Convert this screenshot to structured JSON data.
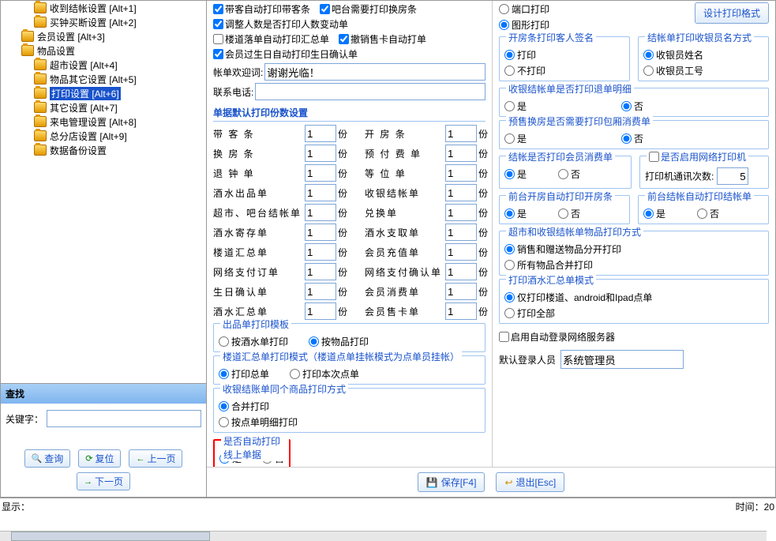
{
  "tree": [
    {
      "label": "收到结帐设置 [Alt+1]",
      "indent": 1
    },
    {
      "label": "买钟买断设置 [Alt+2]",
      "indent": 1
    },
    {
      "label": "会员设置 [Alt+3]",
      "indent": 0
    },
    {
      "label": "物品设置",
      "indent": 0
    },
    {
      "label": "超市设置 [Alt+4]",
      "indent": 1
    },
    {
      "label": "物品其它设置 [Alt+5]",
      "indent": 1
    },
    {
      "label": "打印设置 [Alt+6]",
      "indent": 1,
      "selected": true
    },
    {
      "label": "其它设置 [Alt+7]",
      "indent": 1
    },
    {
      "label": "来电管理设置 [Alt+8]",
      "indent": 1
    },
    {
      "label": "总分店设置 [Alt+9]",
      "indent": 1
    },
    {
      "label": "数据备份设置",
      "indent": 1
    }
  ],
  "find": {
    "header": "查找",
    "keyword": "关键字：",
    "q": "查询",
    "r": "复位",
    "p": "上一页",
    "n": "下一页",
    "kw_val": ""
  },
  "chk": {
    "c1": "带客自动打印带客条",
    "c2": "吧台需要打印换房条",
    "c3": "调整人数是否打印人数变动单",
    "c4": "楼道落单自动打印汇总单",
    "c5": "撤销售卡自动打单",
    "c6": "会员过生日自动打印生日确认单"
  },
  "fld": {
    "welcome_lbl": "帐单欢迎词:",
    "welcome_val": "谢谢光临！",
    "tel_lbl": "联系电话:",
    "tel_val": ""
  },
  "copies": {
    "title": "单据默认打印份数设置",
    "rows": [
      [
        "带  客  条",
        "1",
        "份",
        "开  房  条",
        "1",
        "份"
      ],
      [
        "换  房  条",
        "1",
        "份",
        "预 付 费 单",
        "1",
        "份"
      ],
      [
        "退  钟  单",
        "1",
        "份",
        "等  位  单",
        "1",
        "份"
      ],
      [
        "酒水出品单",
        "1",
        "份",
        "收银结帐单",
        "1",
        "份"
      ],
      [
        "超市、吧台结帐单",
        "1",
        "份",
        "兑换单",
        "1",
        "份"
      ],
      [
        "酒水寄存单",
        "1",
        "份",
        "酒水支取单",
        "1",
        "份"
      ],
      [
        "楼道汇总单",
        "1",
        "份",
        "会员充值单",
        "1",
        "份"
      ],
      [
        "网络支付订单",
        "1",
        "份",
        "网络支付确认单",
        "1",
        "份"
      ],
      [
        "生日确认单",
        "1",
        "份",
        "会员消费单",
        "1",
        "份"
      ],
      [
        "酒水汇总单",
        "1",
        "份",
        "会员售卡单",
        "1",
        "份"
      ]
    ]
  },
  "g1": {
    "t": "出品单打印模板",
    "a": "按酒水单打印",
    "b": "按物品打印"
  },
  "g2": {
    "t": "楼道汇总单打印模式（楼道点单挂帐模式为点单员挂帐）",
    "a": "打印总单",
    "b": "打印本次点单"
  },
  "g3": {
    "t": "收银结账单同个商品打印方式",
    "a": "合并打印",
    "b": "按点单明细打印"
  },
  "g4": {
    "t": "是否自动打印线上单据",
    "a": "是",
    "b": "否"
  },
  "rTop": {
    "a": "端口打印",
    "b": "图形打印",
    "btn": "设计打印格式"
  },
  "rg": [
    {
      "t": "开房条打印客人签名",
      "a": "打印",
      "b": "不打印"
    },
    {
      "t": "结帐单打印收银员名方式",
      "a": "收银员姓名",
      "b": "收银员工号"
    }
  ],
  "rg2": [
    {
      "t": "收银结帐单是否打印退单明细",
      "a": "是",
      "b": "否"
    },
    {
      "t": "预售换房是否需要打印包厢消费单",
      "a": "是",
      "b": "否"
    }
  ],
  "rg3a": {
    "t": "结帐是否打印会员消费单",
    "a": "是",
    "b": "否"
  },
  "rg3b": {
    "t": "是否启用网络打印机",
    "lbl": "打印机通讯次数:",
    "val": "5"
  },
  "rg4": [
    {
      "t": "前台开房自动打印开房条",
      "a": "是",
      "b": "否"
    },
    {
      "t": "前台结帐自动打印结帐单",
      "a": "是",
      "b": "否"
    }
  ],
  "rg5": {
    "t": "超市和收银结帐单物品打印方式",
    "a": "销售和赠送物品分开打印",
    "b": "所有物品合并打印"
  },
  "rg6": {
    "t": "打印酒水汇总单模式",
    "a": "仅打印楼道、android和Ipad点单",
    "b": "打印全部"
  },
  "auto": {
    "t": "启用自动登录网络服务器"
  },
  "defu": {
    "lbl": "默认登录人员",
    "val": "系统管理员"
  },
  "bb": {
    "save": "保存[F4]",
    "exit": "退出[Esc]"
  },
  "status": {
    "l": "显示：",
    "r": "时间：20"
  }
}
